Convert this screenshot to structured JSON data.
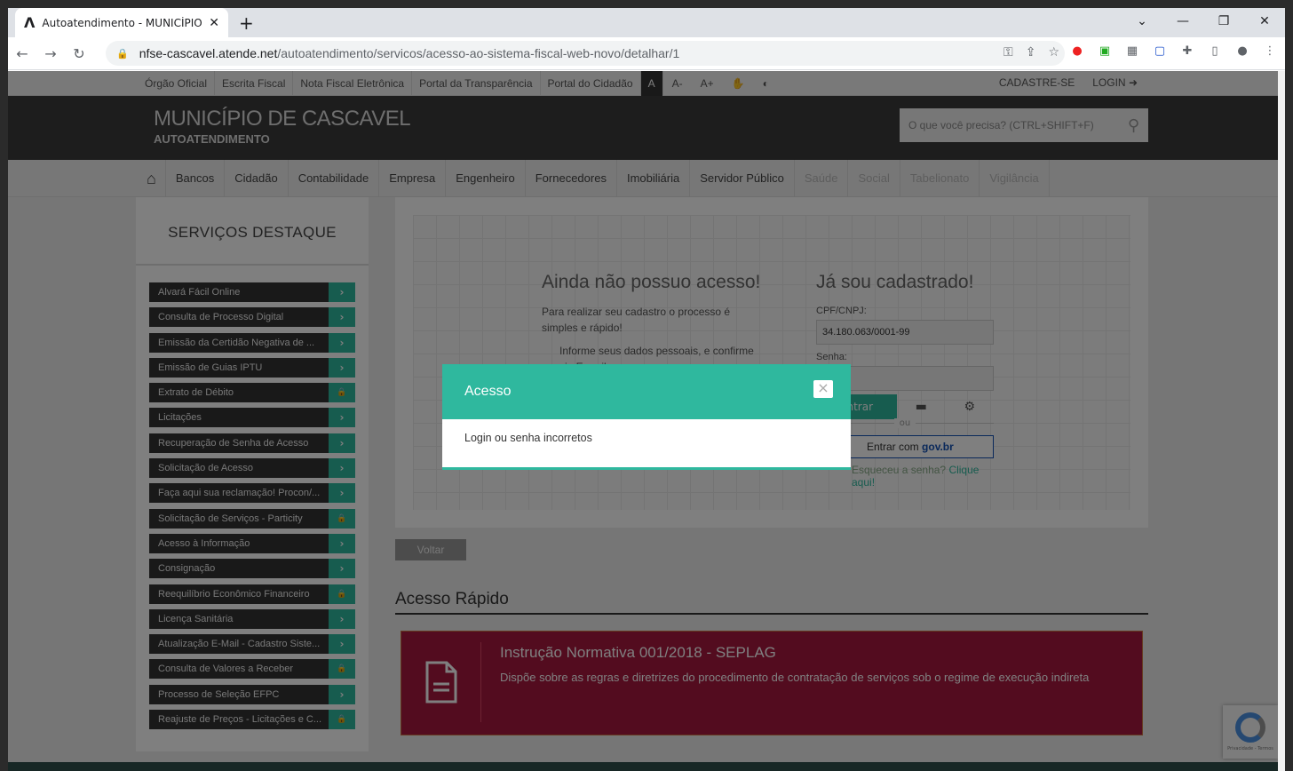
{
  "browser": {
    "tab_title": "Autoatendimento - MUNICÍPIO D",
    "url_domain": "nfse-cascavel.atende.net",
    "url_path": "/autoatendimento/servicos/acesso-ao-sistema-fiscal-web-novo/detalhar/1"
  },
  "topbar": {
    "links": [
      "Órgão Oficial",
      "Escrita Fiscal",
      "Nota Fiscal Eletrônica",
      "Portal da Transparência",
      "Portal do Cidadão"
    ],
    "font_normal": "A",
    "font_minus": "A-",
    "font_plus": "A+",
    "signup": "CADASTRE-SE",
    "login": "LOGIN"
  },
  "header": {
    "title": "MUNICÍPIO DE CASCAVEL",
    "subtitle": "AUTOATENDIMENTO",
    "search_placeholder": "O que você precisa? (CTRL+SHIFT+F)"
  },
  "categories": [
    "Bancos",
    "Cidadão",
    "Contabilidade",
    "Empresa",
    "Engenheiro",
    "Fornecedores",
    "Imobiliária",
    "Servidor Público",
    "Saúde",
    "Social",
    "Tabelionato",
    "Vigilância"
  ],
  "sidebar": {
    "title": "SERVIÇOS DESTAQUE",
    "items": [
      {
        "label": "Alvará Fácil Online",
        "locked": false
      },
      {
        "label": "Consulta de Processo Digital",
        "locked": false
      },
      {
        "label": "Emissão da Certidão Negativa de ...",
        "locked": false
      },
      {
        "label": "Emissão de Guias IPTU",
        "locked": false
      },
      {
        "label": "Extrato de Débito",
        "locked": true
      },
      {
        "label": "Licitações",
        "locked": false
      },
      {
        "label": "Recuperação de Senha de Acesso",
        "locked": false
      },
      {
        "label": "Solicitação de Acesso",
        "locked": false
      },
      {
        "label": "Faça aqui sua reclamação! Procon/...",
        "locked": false
      },
      {
        "label": "Solicitação de Serviços - Particity",
        "locked": true
      },
      {
        "label": "Acesso à Informação",
        "locked": false
      },
      {
        "label": "Consignação",
        "locked": false
      },
      {
        "label": "Reequilíbrio Econômico Financeiro",
        "locked": true
      },
      {
        "label": "Licença Sanitária",
        "locked": false
      },
      {
        "label": "Atualização E-Mail - Cadastro Siste...",
        "locked": false
      },
      {
        "label": "Consulta de Valores a Receber",
        "locked": true
      },
      {
        "label": "Processo de Seleção EFPC",
        "locked": false
      },
      {
        "label": "Reajuste de Preços - Licitações e C...",
        "locked": true
      }
    ]
  },
  "access": {
    "no_access_title": "Ainda não possuo acesso!",
    "no_access_text": "Para realizar seu cadastro o processo é simples e rápido!",
    "step1": "Informe seus dados pessoais, e confirme via E-mail;",
    "registered_title": "Já sou cadastrado!",
    "cpf_label": "CPF/CNPJ:",
    "cpf_value": "34.180.063/0001-99",
    "password_label": "Senha:",
    "enter_label": "Entrar",
    "or_label": "ou",
    "gov_label": "Entrar com",
    "gov_brand": "gov.br",
    "forgot_text": "Esqueceu a senha?",
    "forgot_link": "Clique aqui!"
  },
  "back_label": "Voltar",
  "quick_access": {
    "title": "Acesso Rápido",
    "card_title": "Instrução Normativa 001/2018 - SEPLAG",
    "card_desc": "Dispõe sobre as regras e diretrizes do procedimento de contratação de serviços sob o regime de execução indireta"
  },
  "modal": {
    "title": "Acesso",
    "message": "Login ou senha incorretos",
    "close": "×"
  },
  "recaptcha": "Privacidade - Termos"
}
